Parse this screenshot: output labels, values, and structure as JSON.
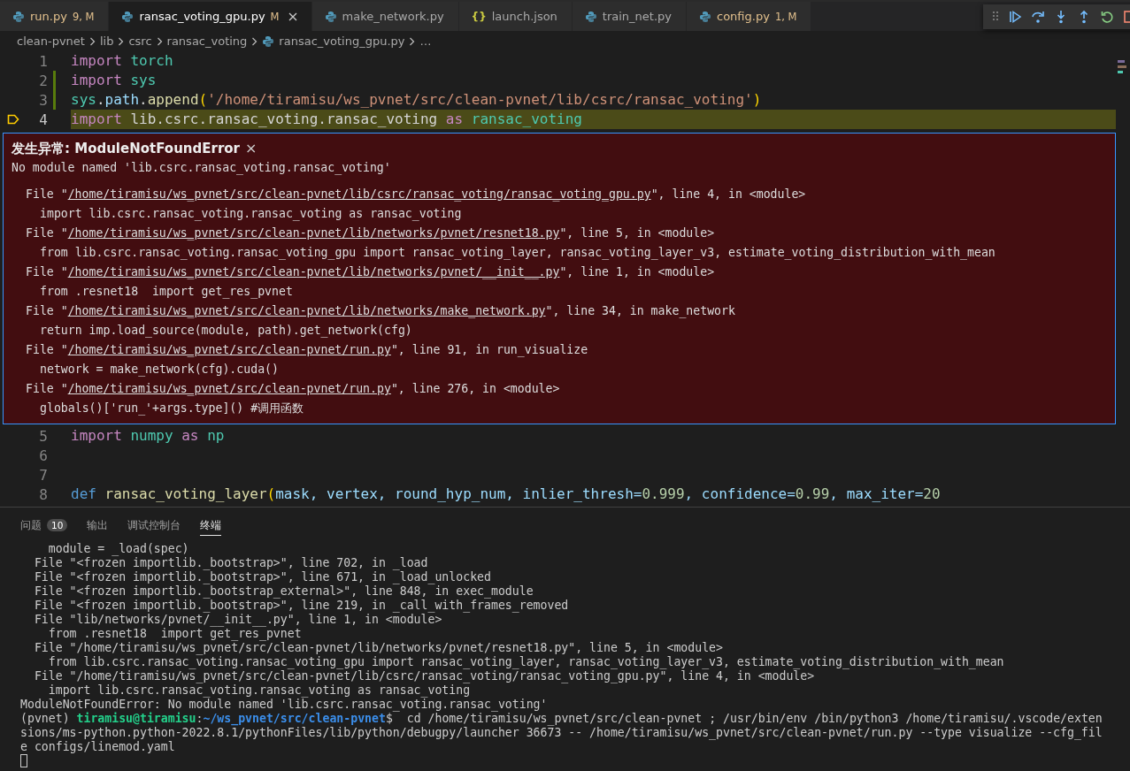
{
  "tabs": [
    {
      "label": "run.py",
      "kind": "python",
      "badge": "9, M",
      "decorated": true,
      "selected": false
    },
    {
      "label": "ransac_voting_gpu.py",
      "kind": "python",
      "badge": "M",
      "decorated": false,
      "selected": true
    },
    {
      "label": "make_network.py",
      "kind": "python",
      "decorated": false,
      "selected": false
    },
    {
      "label": "launch.json",
      "kind": "json",
      "icon_text": "{}",
      "decorated": false,
      "selected": false
    },
    {
      "label": "train_net.py",
      "kind": "python",
      "decorated": false,
      "selected": false
    },
    {
      "label": "config.py",
      "kind": "python",
      "badge": "1, M",
      "decorated": true,
      "selected": false
    }
  ],
  "debug_toolbar": [
    {
      "kind": "continue"
    },
    {
      "kind": "step_over"
    },
    {
      "kind": "step_into"
    },
    {
      "kind": "step_out"
    },
    {
      "kind": "restart"
    },
    {
      "kind": "stop"
    }
  ],
  "breadcrumb": [
    {
      "text": "clean-pvnet",
      "kind": "folder"
    },
    {
      "text": "lib",
      "kind": "folder"
    },
    {
      "text": "csrc",
      "kind": "folder"
    },
    {
      "text": "ransac_voting",
      "kind": "folder"
    },
    {
      "text": "ransac_voting_gpu.py",
      "kind": "python"
    },
    {
      "text": "…",
      "kind": "folder"
    }
  ],
  "editor": {
    "lines_top": [
      {
        "number": "1",
        "changed": false,
        "current": false,
        "tokens": [
          {
            "text": "import ",
            "kind": "kw"
          },
          {
            "text": "torch",
            "kind": "mod"
          }
        ]
      },
      {
        "number": "2",
        "changed": true,
        "current": false,
        "tokens": [
          {
            "text": "import ",
            "kind": "kw"
          },
          {
            "text": "sys",
            "kind": "mod"
          }
        ]
      },
      {
        "number": "3",
        "changed": true,
        "current": false,
        "tokens": [
          {
            "text": "sys",
            "kind": "mod"
          },
          {
            "text": ".",
            "kind": "plain"
          },
          {
            "text": "path",
            "kind": "var"
          },
          {
            "text": ".",
            "kind": "plain"
          },
          {
            "text": "append",
            "kind": "fn"
          },
          {
            "text": "(",
            "kind": "paren"
          },
          {
            "text": "'/home/tiramisu/ws_pvnet/src/clean-pvnet/lib/csrc/ransac_voting'",
            "kind": "str"
          },
          {
            "text": ")",
            "kind": "paren"
          }
        ]
      },
      {
        "number": "4",
        "changed": false,
        "current": true,
        "tokens": [
          {
            "text": "import",
            "kind": "kw"
          },
          {
            "text": " lib.csrc.ransac_voting.ransac_voting ",
            "kind": "plain"
          },
          {
            "text": "as ",
            "kind": "kw"
          },
          {
            "text": "ransac_voting",
            "kind": "mod"
          }
        ]
      }
    ],
    "exception": {
      "title": "发生异常: ModuleNotFoundError",
      "close": "×",
      "message": "No module named 'lib.csrc.ransac_voting.ransac_voting'",
      "frames": [
        {
          "prefix": "File \"",
          "file": "/home/tiramisu/ws_pvnet/src/clean-pvnet/lib/csrc/ransac_voting/ransac_voting_gpu.py",
          "where": "\", line 4, in <module>",
          "code": "import lib.csrc.ransac_voting.ransac_voting as ransac_voting"
        },
        {
          "prefix": "File \"",
          "file": "/home/tiramisu/ws_pvnet/src/clean-pvnet/lib/networks/pvnet/resnet18.py",
          "where": "\", line 5, in <module>",
          "code": "from lib.csrc.ransac_voting.ransac_voting_gpu import ransac_voting_layer, ransac_voting_layer_v3, estimate_voting_distribution_with_mean"
        },
        {
          "prefix": "File \"",
          "file": "/home/tiramisu/ws_pvnet/src/clean-pvnet/lib/networks/pvnet/__init__.py",
          "where": "\", line 1, in <module>",
          "code": "from .resnet18  import get_res_pvnet"
        },
        {
          "prefix": "File \"",
          "file": "/home/tiramisu/ws_pvnet/src/clean-pvnet/lib/networks/make_network.py",
          "where": "\", line 34, in make_network",
          "code": "return imp.load_source(module, path).get_network(cfg)"
        },
        {
          "prefix": "File \"",
          "file": "/home/tiramisu/ws_pvnet/src/clean-pvnet/run.py",
          "where": "\", line 91, in run_visualize",
          "code": "network = make_network(cfg).cuda()"
        },
        {
          "prefix": "File \"",
          "file": "/home/tiramisu/ws_pvnet/src/clean-pvnet/run.py",
          "where": "\", line 276, in <module>",
          "code": "globals()['run_'+args.type]() #调用函数"
        }
      ]
    },
    "lines_bottom": [
      {
        "number": "5",
        "changed": false,
        "current": false,
        "tokens": [
          {
            "text": "import ",
            "kind": "kw"
          },
          {
            "text": "numpy ",
            "kind": "mod"
          },
          {
            "text": "as ",
            "kind": "kw"
          },
          {
            "text": "np",
            "kind": "mod"
          }
        ]
      },
      {
        "number": "6",
        "changed": false,
        "current": false
      },
      {
        "number": "7",
        "changed": false,
        "current": false
      },
      {
        "number": "8",
        "changed": false,
        "current": false,
        "tokens": [
          {
            "text": "def ",
            "kind": "def"
          },
          {
            "text": "ransac_voting_layer",
            "kind": "fn"
          },
          {
            "text": "(",
            "kind": "paren"
          },
          {
            "text": "mask, vertex, round_hyp_num, inlier_thresh=",
            "kind": "var"
          },
          {
            "text": "0.999",
            "kind": "num"
          },
          {
            "text": ", confidence=",
            "kind": "var"
          },
          {
            "text": "0.99",
            "kind": "num"
          },
          {
            "text": ", max_iter=",
            "kind": "var"
          },
          {
            "text": "20",
            "kind": "num"
          }
        ]
      }
    ]
  },
  "panel": {
    "tabs": [
      {
        "label": "问题",
        "count": "10",
        "selected": false
      },
      {
        "label": "输出",
        "selected": false
      },
      {
        "label": "调试控制台",
        "selected": false
      },
      {
        "label": "终端",
        "selected": true
      }
    ],
    "terminal": [
      {
        "kind": "plain",
        "text": "    module = _load(spec)"
      },
      {
        "kind": "plain",
        "text": "  File \"<frozen importlib._bootstrap>\", line 702, in _load"
      },
      {
        "kind": "plain",
        "text": "  File \"<frozen importlib._bootstrap>\", line 671, in _load_unlocked"
      },
      {
        "kind": "plain",
        "text": "  File \"<frozen importlib._bootstrap_external>\", line 848, in exec_module"
      },
      {
        "kind": "plain",
        "text": "  File \"<frozen importlib._bootstrap>\", line 219, in _call_with_frames_removed"
      },
      {
        "kind": "plain",
        "text": "  File \"lib/networks/pvnet/__init__.py\", line 1, in <module>"
      },
      {
        "kind": "plain",
        "text": "    from .resnet18  import get_res_pvnet"
      },
      {
        "kind": "plain",
        "text": "  File \"/home/tiramisu/ws_pvnet/src/clean-pvnet/lib/networks/pvnet/resnet18.py\", line 5, in <module>"
      },
      {
        "kind": "plain",
        "text": "    from lib.csrc.ransac_voting.ransac_voting_gpu import ransac_voting_layer, ransac_voting_layer_v3, estimate_voting_distribution_with_mean"
      },
      {
        "kind": "plain",
        "text": "  File \"/home/tiramisu/ws_pvnet/src/clean-pvnet/lib/csrc/ransac_voting/ransac_voting_gpu.py\", line 4, in <module>"
      },
      {
        "kind": "plain",
        "text": "    import lib.csrc.ransac_voting.ransac_voting as ransac_voting"
      },
      {
        "kind": "plain",
        "text": "ModuleNotFoundError: No module named 'lib.csrc.ransac_voting.ransac_voting'"
      },
      {
        "kind": "prompt",
        "env": "(pvnet) ",
        "user": "tiramisu@tiramisu",
        "sep": ":",
        "path": "~/ws_pvnet/src/clean-pvnet",
        "command": "$  cd /home/tiramisu/ws_pvnet/src/clean-pvnet ; /usr/bin/env /bin/python3 /home/tiramisu/.vscode/exten"
      },
      {
        "kind": "plain",
        "text": "sions/ms-python.python-2022.8.1/pythonFiles/lib/python/debugpy/launcher 36673 -- /home/tiramisu/ws_pvnet/src/clean-pvnet/run.py --type visualize --cfg_fil"
      },
      {
        "kind": "plain",
        "text": "e configs/linemod.yaml"
      },
      {
        "kind": "cursor"
      }
    ]
  }
}
